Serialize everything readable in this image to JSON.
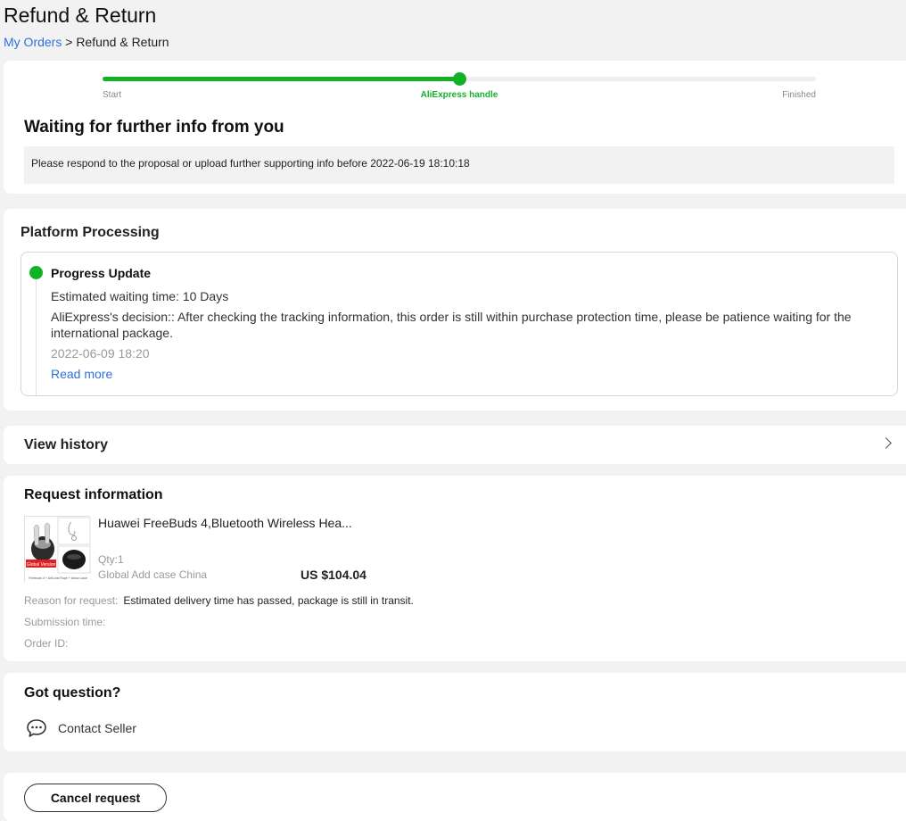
{
  "page": {
    "title": "Refund & Return",
    "breadcrumb": {
      "link": "My Orders",
      "separator": " > ",
      "current": "Refund & Return"
    }
  },
  "progress": {
    "steps": [
      {
        "label": "Start",
        "state": "done"
      },
      {
        "label": "AliExpress handle",
        "state": "current"
      },
      {
        "label": "Finished",
        "state": "pending"
      }
    ],
    "fraction": 0.5,
    "accent_color": "#12b227",
    "status_title": "Waiting for further info from you",
    "status_note": "Please respond to the proposal or upload further supporting info before 2022-06-19 18:10:18"
  },
  "platform": {
    "heading": "Platform Processing",
    "update": {
      "title": "Progress Update",
      "waiting": "Estimated waiting time: 10 Days",
      "decision": "AliExpress's decision:: After checking the tracking information, this order is still within purchase protection time, please be patience waiting for the international package.",
      "date": "2022-06-09 18:20",
      "read_more": "Read more"
    }
  },
  "history": {
    "label": "View history",
    "icon": "chevron-right-icon"
  },
  "request": {
    "heading": "Request information",
    "product": {
      "name": "Huawei FreeBuds 4,Bluetooth Wireless Hea...",
      "qty": "Qty:1",
      "variant": "Global Add case China",
      "price": "US $104.04",
      "thumb_badge": "Global Version",
      "thumb_caption": "Freebuds 4 + Anti-lost Rope + silicon case"
    },
    "reason_label": "Reason for request:",
    "reason_value": "Estimated delivery time has passed, package is still in transit.",
    "submission_label": "Submission time:",
    "order_label": "Order ID:"
  },
  "question": {
    "heading": "Got question?",
    "contact_label": "Contact Seller",
    "icon": "chat-bubble-icon"
  },
  "actions": {
    "cancel_label": "Cancel request"
  }
}
